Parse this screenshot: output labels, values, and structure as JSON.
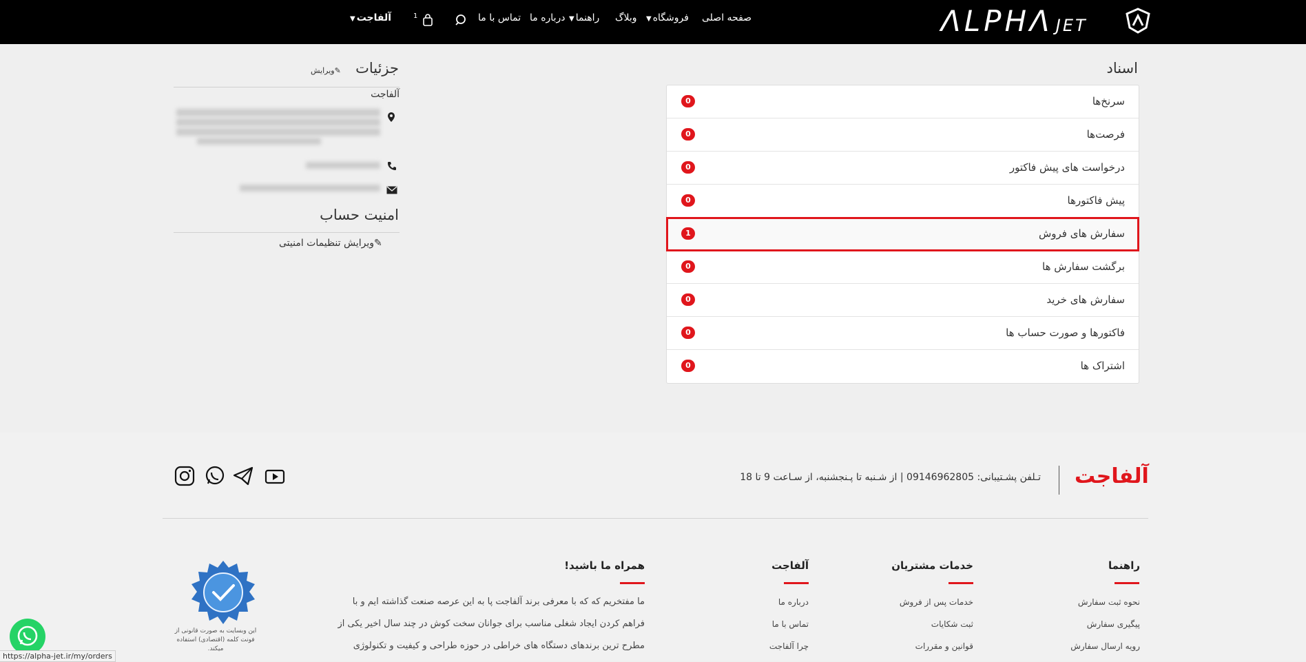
{
  "header": {
    "logo_text": "ΛLPHΛ",
    "logo_sub": "JET",
    "nav": {
      "home": "صفحه اصلی",
      "shop": "فروشگاه",
      "blog": "وبلاگ",
      "guide": "راهنما",
      "about": "درباره ما",
      "contact": "تماس با ما",
      "cart_count": "1",
      "account": "آلفاجت"
    }
  },
  "documents": {
    "title": "اسناد",
    "items": [
      {
        "label": "سرنخ‌ها",
        "count": "0"
      },
      {
        "label": "فرصت‌ها",
        "count": "0"
      },
      {
        "label": "درخواست های پیش فاکتور",
        "count": "0"
      },
      {
        "label": "پیش فاکتورها",
        "count": "0"
      },
      {
        "label": "سفارش های فروش",
        "count": "1"
      },
      {
        "label": "برگشت سفارش ها",
        "count": "0"
      },
      {
        "label": "سفارش های خرید",
        "count": "0"
      },
      {
        "label": "فاکتورها و صورت حساب ها",
        "count": "0"
      },
      {
        "label": "اشتراک ها",
        "count": "0"
      }
    ]
  },
  "details": {
    "title": "جزئیات",
    "edit_label": "ویرایش",
    "company": "آلفاجت"
  },
  "security": {
    "title": "امنیت حساب",
    "edit_label": "ویرایش تنظیمات امنیتی"
  },
  "footer": {
    "brand": "آلفاجت",
    "support": "تـلفن پشـتیبانی: 09146962805  |  از شـنبه تا پـنجشنبه، از سـاعت 9 تا 18",
    "columns": {
      "guide": {
        "title": "راهنما",
        "links": [
          "نحوه ثبت سفارش",
          "پیگیری سفارش",
          "رویه ارسال سفارش"
        ]
      },
      "services": {
        "title": "خدمات مشتریان",
        "links": [
          "خدمات پس از فروش",
          "ثبت شکایات",
          "قوانین و مقررات"
        ]
      },
      "alphajet": {
        "title": "آلفاجت",
        "links": [
          "درباره ما",
          "تماس با ما",
          "چرا آلفاجت"
        ]
      },
      "with_us": {
        "title": "همراه ما باشید!",
        "lines": [
          "ما مفتخریم که که با معرفی برند آلفاجت پا به این عرصه صنعت گذاشته ایم و با",
          "فراهم کردن ایجاد شغلی مناسب برای جوانان سخت کوش در چند سال اخیر یکی از",
          "مطرح ترین برندهای دستگاه های خراطی در حوزه طراحی و کیفیت و تکنولوژی"
        ]
      }
    },
    "font_notice": "این وبسایت به صورت قانونی از فونت کلمه (اقتصادی) استفاده میکند.",
    "status_url": "https://alpha-jet.ir/my/orders"
  },
  "colors": {
    "accent": "#e0161c",
    "header_bg": "#000000",
    "whatsapp": "#25d366"
  }
}
